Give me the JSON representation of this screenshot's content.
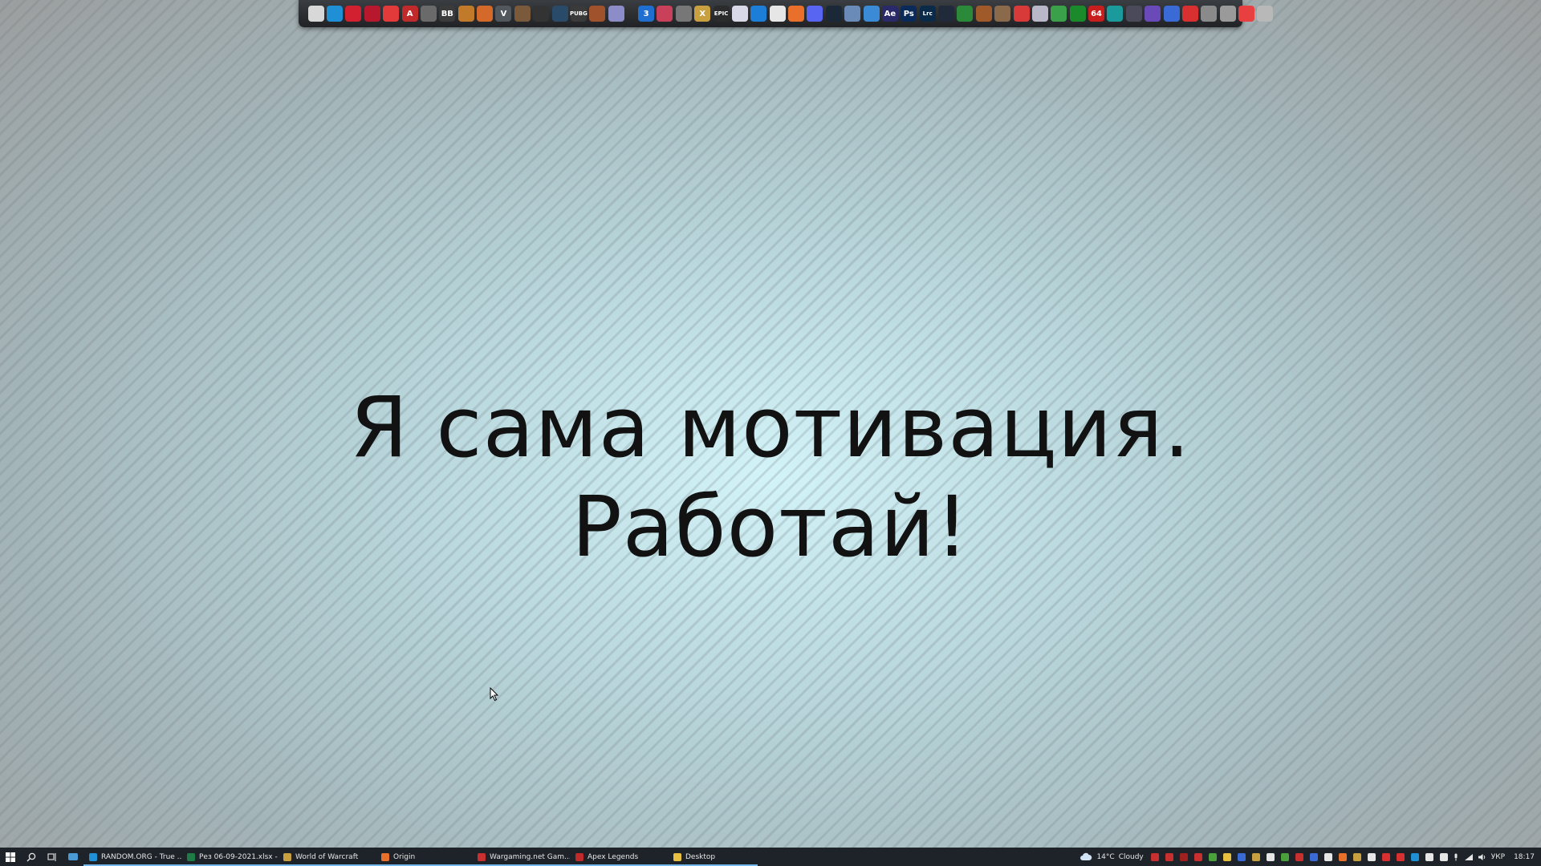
{
  "dock": {
    "icons_left": [
      {
        "name": "file-explorer-icon",
        "color": "#d8d8d8",
        "text": ""
      },
      {
        "name": "edge-icon",
        "color": "#1f8fd6",
        "text": ""
      },
      {
        "name": "opera-icon",
        "color": "#d22030",
        "text": ""
      },
      {
        "name": "opera-gx-icon",
        "color": "#b8182e",
        "text": ""
      },
      {
        "name": "vivaldi-icon",
        "color": "#e23a3a",
        "text": ""
      },
      {
        "name": "apex-legends-icon",
        "color": "#c02a2a",
        "text": "A"
      },
      {
        "name": "game-icon-1",
        "color": "#6a6a6a",
        "text": ""
      },
      {
        "name": "bb-icon",
        "color": "#3b3b3b",
        "text": "BB"
      },
      {
        "name": "game-icon-2",
        "color": "#c07a2a",
        "text": ""
      },
      {
        "name": "game-icon-3",
        "color": "#d4692a",
        "text": ""
      },
      {
        "name": "valorant-icon",
        "color": "#50585e",
        "text": "V"
      },
      {
        "name": "game-icon-4",
        "color": "#7a5a3a",
        "text": ""
      },
      {
        "name": "game-icon-5",
        "color": "#333333",
        "text": ""
      },
      {
        "name": "game-icon-6",
        "color": "#2a4a6a",
        "text": ""
      },
      {
        "name": "pubg-icon",
        "color": "#3a3a3a",
        "text": "PUBG"
      },
      {
        "name": "game-icon-7",
        "color": "#a0522d",
        "text": ""
      },
      {
        "name": "game-icon-8",
        "color": "#8c8cc8",
        "text": ""
      }
    ],
    "icons_right": [
      {
        "name": "app-3-icon",
        "color": "#1e6fd0",
        "text": "3"
      },
      {
        "name": "app-camera-icon",
        "color": "#c8405a",
        "text": ""
      },
      {
        "name": "app-gear-icon",
        "color": "#777777",
        "text": ""
      },
      {
        "name": "app-x-icon",
        "color": "#c8a040",
        "text": "X"
      },
      {
        "name": "epic-games-icon",
        "color": "#2b2b2b",
        "text": "EPIC"
      },
      {
        "name": "ubisoft-icon",
        "color": "#d8d8e8",
        "text": ""
      },
      {
        "name": "battlenet-icon",
        "color": "#1c7ed6",
        "text": ""
      },
      {
        "name": "app-plus-icon",
        "color": "#e6e6e6",
        "text": ""
      },
      {
        "name": "origin-icon",
        "color": "#e8702a",
        "text": ""
      },
      {
        "name": "discord-icon",
        "color": "#5865f2",
        "text": ""
      },
      {
        "name": "steam-icon",
        "color": "#1b2838",
        "text": ""
      },
      {
        "name": "app-grid-icon",
        "color": "#6a8ab8",
        "text": ""
      },
      {
        "name": "app-blue-icon",
        "color": "#3a8ad6",
        "text": ""
      },
      {
        "name": "after-effects-icon",
        "color": "#2a2a6a",
        "text": "Ae"
      },
      {
        "name": "photoshop-icon",
        "color": "#0a2a5a",
        "text": "Ps"
      },
      {
        "name": "lightroom-icon",
        "color": "#0a2a4a",
        "text": "Lrc"
      },
      {
        "name": "app-circle-icon",
        "color": "#202a3a",
        "text": ""
      },
      {
        "name": "app-green-icon",
        "color": "#2a8a3a",
        "text": ""
      },
      {
        "name": "app-tools-icon",
        "color": "#a05a2a",
        "text": ""
      },
      {
        "name": "app-puzzle-icon",
        "color": "#8a6a4a",
        "text": ""
      },
      {
        "name": "app-red-circle-icon",
        "color": "#d83a3a",
        "text": ""
      },
      {
        "name": "app-ball-icon",
        "color": "#b8b8c8",
        "text": ""
      },
      {
        "name": "app-cash-icon",
        "color": "#3aa04a",
        "text": ""
      },
      {
        "name": "xbox-icon",
        "color": "#1a8a2a",
        "text": ""
      },
      {
        "name": "app-64-icon",
        "color": "#c81e1e",
        "text": "64"
      },
      {
        "name": "app-teal-icon",
        "color": "#1a9a9a",
        "text": ""
      },
      {
        "name": "app-dark-icon",
        "color": "#4a4a5a",
        "text": ""
      },
      {
        "name": "app-purple-icon",
        "color": "#6a4ab8",
        "text": ""
      },
      {
        "name": "app-monitor-icon",
        "color": "#3a6ad6",
        "text": ""
      },
      {
        "name": "app-bolt-icon",
        "color": "#d83030",
        "text": ""
      },
      {
        "name": "app-device-icon",
        "color": "#8a8a8a",
        "text": ""
      },
      {
        "name": "app-cloud-icon",
        "color": "#9a9a9a",
        "text": ""
      },
      {
        "name": "app-red-sq-icon",
        "color": "#e84040",
        "text": ""
      },
      {
        "name": "recycle-bin-icon",
        "color": "#b8b8b8",
        "text": ""
      }
    ]
  },
  "wallpaper": {
    "line1": "Я сама мотивация.",
    "line2": "Работай!"
  },
  "taskbar": {
    "apps": [
      {
        "name": "taskbar-app-random-org",
        "label": "RANDOM.ORG - True ...",
        "color": "#1f8fd6",
        "active": true
      },
      {
        "name": "taskbar-app-excel",
        "label": "Рез 06-09-2021.xlsx - ...",
        "color": "#1e7b45",
        "active": true
      },
      {
        "name": "taskbar-app-wow",
        "label": "World of Warcraft",
        "color": "#c8a040",
        "active": true
      },
      {
        "name": "taskbar-app-origin",
        "label": "Origin",
        "color": "#e8702a",
        "active": true
      },
      {
        "name": "taskbar-app-wargaming",
        "label": "Wargaming.net Gam...",
        "color": "#c83030",
        "active": true
      },
      {
        "name": "taskbar-app-apex",
        "label": "Apex Legends",
        "color": "#c02a2a",
        "active": true
      },
      {
        "name": "taskbar-app-desktop",
        "label": "Desktop",
        "color": "#e8c040",
        "active": true
      }
    ],
    "weather_temp": "14°C",
    "weather_desc": "Cloudy",
    "language": "УКР",
    "time": "18:17",
    "tray_colors": [
      "#c83030",
      "#c83030",
      "#a02020",
      "#c83030",
      "#4aa03a",
      "#e8c040",
      "#3a6ad6",
      "#c8a040",
      "#e6e6e6",
      "#4aa03a",
      "#c83030",
      "#3a6ad6",
      "#e6e6e6",
      "#e8702a",
      "#c8a040",
      "#e6e6e6",
      "#d83030",
      "#d83030",
      "#1f8fd6",
      "#e6e6e6",
      "#e6e6e6"
    ]
  }
}
